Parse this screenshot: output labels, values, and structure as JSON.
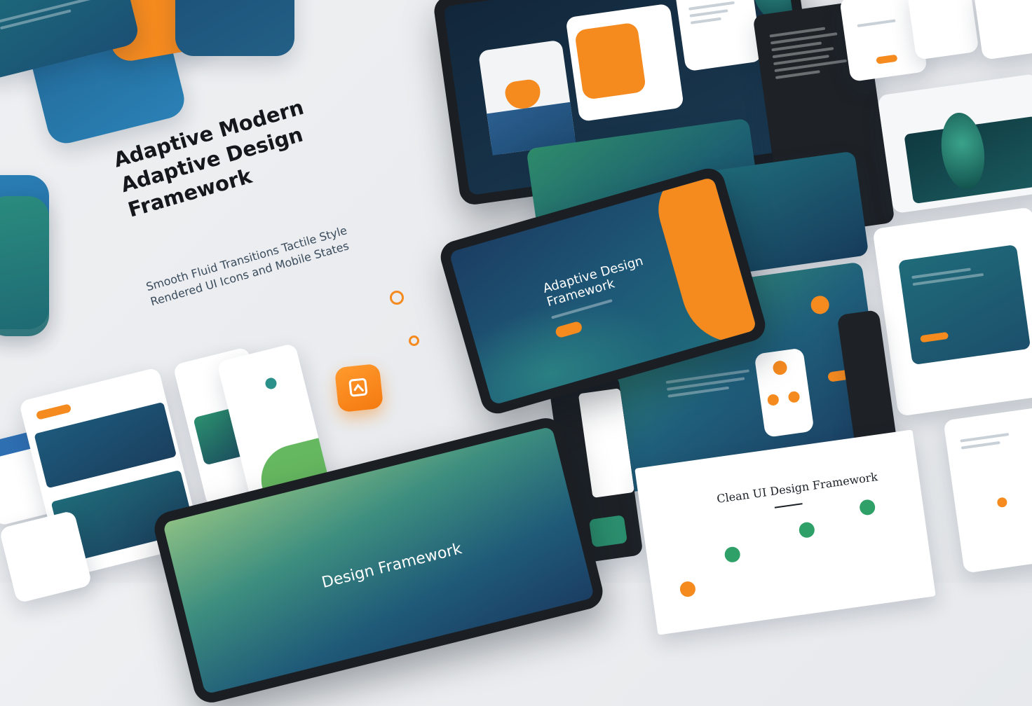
{
  "hero": {
    "title_lines": [
      "Adaptive Modern",
      "Adaptive Design",
      "Framework"
    ],
    "subtitle_lines": [
      "Smooth Fluid Transitions Tactile Style",
      "Rendered UI Icons and Mobile States"
    ]
  },
  "tablet_center": {
    "title_lines": [
      "Adaptive Design",
      "Framework"
    ],
    "button_label": ""
  },
  "tablet_bottom": {
    "title": "Design Framework"
  },
  "web_panel": {
    "heading": "Clean UI Design Framework"
  },
  "app_icon": {
    "icon": "layers-icon"
  },
  "colors": {
    "orange": "#f58a1f",
    "teal": "#1f6b7a",
    "navy": "#1d3f63",
    "green": "#5bb36a"
  }
}
